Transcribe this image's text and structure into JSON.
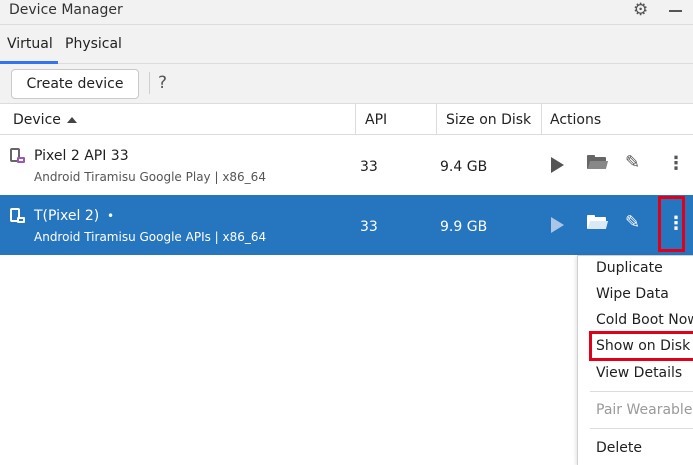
{
  "window": {
    "title": "Device Manager",
    "gear_icon": "gear-icon",
    "minimize_icon": "minimize-icon"
  },
  "tabs": [
    {
      "label": "Virtual",
      "selected": true
    },
    {
      "label": "Physical",
      "selected": false
    }
  ],
  "toolbar": {
    "create_label": "Create device",
    "help_label": "?"
  },
  "table": {
    "columns": [
      "Device",
      "API",
      "Size on Disk",
      "Actions"
    ],
    "sort_column": "Device",
    "sort_direction": "ascending",
    "rows": [
      {
        "name": "Pixel 2 API 33",
        "subtitle": "Android Tiramisu Google Play | x86_64",
        "api": "33",
        "size": "9.4 GB",
        "selected": false,
        "running_dot": ""
      },
      {
        "name": "T(Pixel 2)",
        "subtitle": "Android Tiramisu Google APIs | x86_64",
        "api": "33",
        "size": "9.9 GB",
        "selected": true,
        "running_dot": "•"
      }
    ]
  },
  "context_menu": {
    "items": [
      {
        "label": "Duplicate",
        "enabled": true
      },
      {
        "label": "Wipe Data",
        "enabled": true
      },
      {
        "label": "Cold Boot Now",
        "enabled": true
      },
      {
        "label": "Show on Disk",
        "enabled": true,
        "highlighted": true
      },
      {
        "label": "View Details",
        "enabled": true
      },
      {
        "label": "Pair Wearable",
        "enabled": false
      },
      {
        "label": "Delete",
        "enabled": true
      }
    ]
  },
  "colors": {
    "selected_row": "#2675bf",
    "accent": "#3574f0",
    "highlight_box": "#e0001a"
  }
}
